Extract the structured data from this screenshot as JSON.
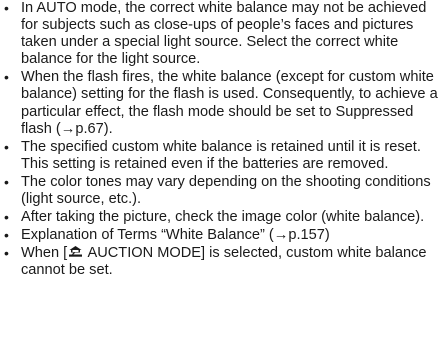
{
  "notes": [
    {
      "text": "In AUTO mode, the correct white balance may not be achieved for subjects such as close-ups of people’s faces and pictures taken under a special light source. Select the correct white balance for the light source."
    },
    {
      "text": "When the flash fires, the white balance (except for custom white balance) setting for the flash is used. Consequently, to achieve a particular effect, the flash mode should be set to Suppressed flash (→p.67)."
    },
    {
      "text": "The specified custom white balance is retained until it is reset. This setting is retained even if the batteries are removed."
    },
    {
      "text": "The color tones may vary depending on the shooting conditions (light source, etc.)."
    },
    {
      "text": "After taking the picture, check the image color (white balance)."
    },
    {
      "text": "Explanation of Terms “White Balance” (→p.157)"
    },
    {
      "text_before": "When [",
      "text_after": " AUCTION MODE] is selected, custom white balance cannot be set.",
      "icon": "auction-mode-icon"
    }
  ],
  "bullet": "•"
}
